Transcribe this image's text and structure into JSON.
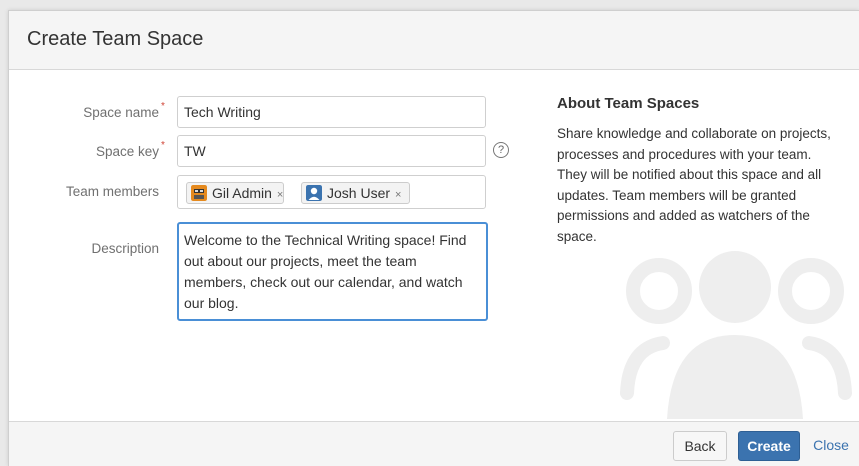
{
  "dialog": {
    "title": "Create Team Space"
  },
  "form": {
    "space_name": {
      "label": "Space name",
      "value": "Tech Writing"
    },
    "space_key": {
      "label": "Space key",
      "value": "TW",
      "help_icon": "question-icon"
    },
    "team_members": {
      "label": "Team members",
      "members": [
        {
          "name": "Gil Admin",
          "remove": "×",
          "avatar_color": "#e58a1f"
        },
        {
          "name": "Josh User",
          "remove": "×",
          "avatar_color": "#3b73af"
        }
      ]
    },
    "description": {
      "label": "Description",
      "value": "Welcome to the Technical Writing space! Find out about our projects, meet the team members, check out our calendar, and watch our blog."
    }
  },
  "about": {
    "title": "About Team Spaces",
    "text": "Share knowledge and collaborate on projects, processes and procedures with your team. They will be notified about this space and all updates. Team members will be granted permissions and added as watchers of the space."
  },
  "footer": {
    "back_label": "Back",
    "create_label": "Create",
    "close_label": "Close"
  },
  "colors": {
    "primary": "#3b73af",
    "required": "#d04437",
    "focus_border": "#4a8fd6"
  }
}
